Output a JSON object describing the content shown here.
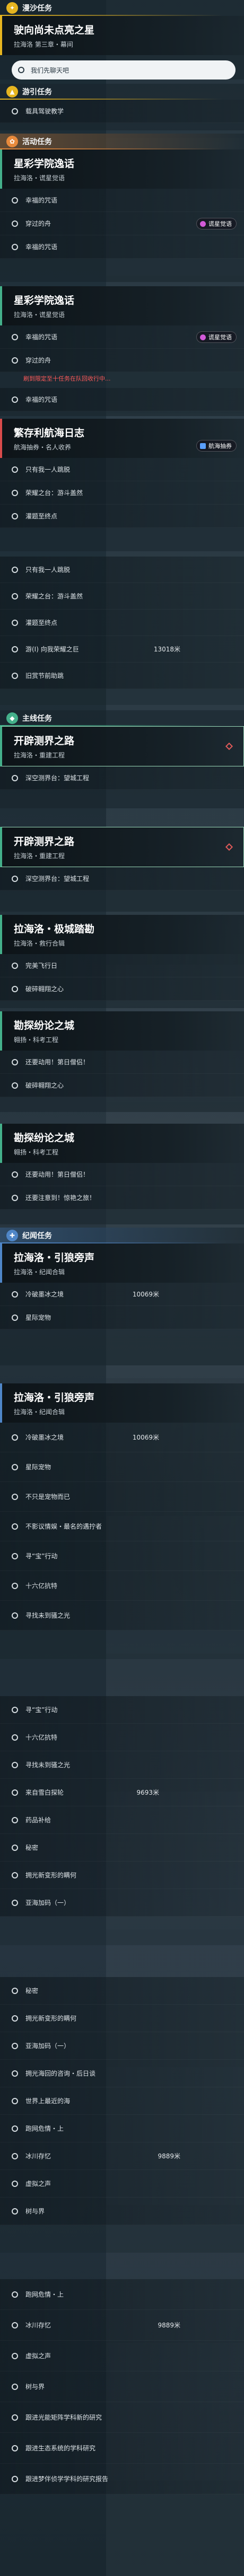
{
  "sections": {
    "dream": "漫沙任务",
    "tour": "游引任务",
    "event": "活动任务",
    "main": "主线任务",
    "record": "纪闻任务"
  },
  "q1": {
    "title": "驶向尚未点亮之星",
    "sub": "拉海洛 第三章・幕间",
    "obj1": "我们先聊天吧"
  },
  "q2": {
    "obj1": "载具驾驶教学"
  },
  "q3": {
    "title": "星彩学院逸话",
    "sub": "拉海洛・谎星觉语",
    "obj1": "幸福的咒语",
    "obj2": "穿过的舟",
    "tag": "谎星觉语"
  },
  "q4": {
    "title": "星彩学院逸话",
    "sub": "拉海洛・谎星觉语",
    "obj1": "幸福的咒语",
    "obj2": "穿过的舟",
    "warn": "刷到限定至十任务在队回收行中...",
    "tag": "谎星觉语"
  },
  "q5": {
    "title": "繁存利航海日志",
    "sub": "航海抽券・名人收养",
    "obj1": "只有我一人跳脱",
    "obj2": "荣耀之台：游斗盖然",
    "obj3": "灌题至终点",
    "tag": "航海抽券"
  },
  "q6": {
    "obj1": "只有我一人跳脱",
    "obj2": "荣耀之台：游斗盖然",
    "obj3": "灌题至终点",
    "obj4": "游(I) 向我荣耀之巨",
    "dist4": "13018米",
    "obj5": "旧赏节前助跳"
  },
  "q7": {
    "title": "开辟测界之路",
    "sub": "拉海洛・重建工程",
    "obj1": "深空测界台：望城工程"
  },
  "q8": {
    "title": "开辟测界之路",
    "sub": "拉海洛・重建工程",
    "obj1": "深空测界台：望城工程"
  },
  "q9": {
    "title": "拉海洛・极城踏勘",
    "sub": "拉海洛・救行合辑",
    "obj1": "完美飞行日",
    "obj2": "破碎翱翔之心"
  },
  "q10": {
    "title": "勘探纷论之城",
    "sub": "翱扬・科考工程",
    "obj1": "还要动用！第日僧侣！",
    "obj2": "破碎翱翔之心"
  },
  "q11": {
    "title": "勘探纷论之城",
    "sub": "翱扬・科考工程",
    "obj1": "还要动用！第日僧侣！",
    "obj2": "还要注意到！惊艳之旅！"
  },
  "q12": {
    "title": "拉海洛・引狼旁声",
    "sub": "拉海洛・纪闻合辑",
    "obj1": "冷破墨冰之境",
    "dist1": "10069米",
    "obj2": "星际宠物"
  },
  "q13": {
    "title": "拉海洛・引狼旁声",
    "sub": "拉海洛・纪闻合辑",
    "obj1": "冷破墨冰之境",
    "dist1": "10069米",
    "obj2": "星际宠物",
    "obj3": "不只是宠物而已",
    "obj4": "不影议情娱・最名的遇拧者",
    "obj5": "寻“宝”行动",
    "obj6": "十六亿抗特",
    "obj7": "寻找未到骚之光"
  },
  "q14": {
    "obj1": "寻“宝”行动",
    "obj2": "十六亿抗特",
    "obj3": "寻找未到骚之光",
    "obj4": "来自雪白探轮",
    "dist4": "9693米",
    "obj5": "药品补给",
    "obj6": "秘密",
    "obj7": "拥光新变形的瞒何",
    "obj8": "亚海加码（一）"
  },
  "q15": {
    "obj1": "秘密",
    "obj2": "拥光新变形的瞒何",
    "obj3": "亚海加码（一）",
    "obj4": "拥光海回的咨询・后日谈",
    "obj5": "世界上最近的海",
    "obj6": "跑网危情・上",
    "obj7": "冰川存忆",
    "dist7": "9889米",
    "obj8": "虚拟之声",
    "obj9": "树与界"
  },
  "q16": {
    "obj1": "跑网危情・上",
    "obj2": "冰川存忆",
    "dist2": "9889米",
    "obj3": "虚拟之声",
    "obj4": "树与界",
    "obj5": "跟进光能矩阵学科新的研究",
    "obj6": "跟进生态系统的学科研究",
    "obj7": "跟进梦伴侦学学科的研究报告"
  }
}
